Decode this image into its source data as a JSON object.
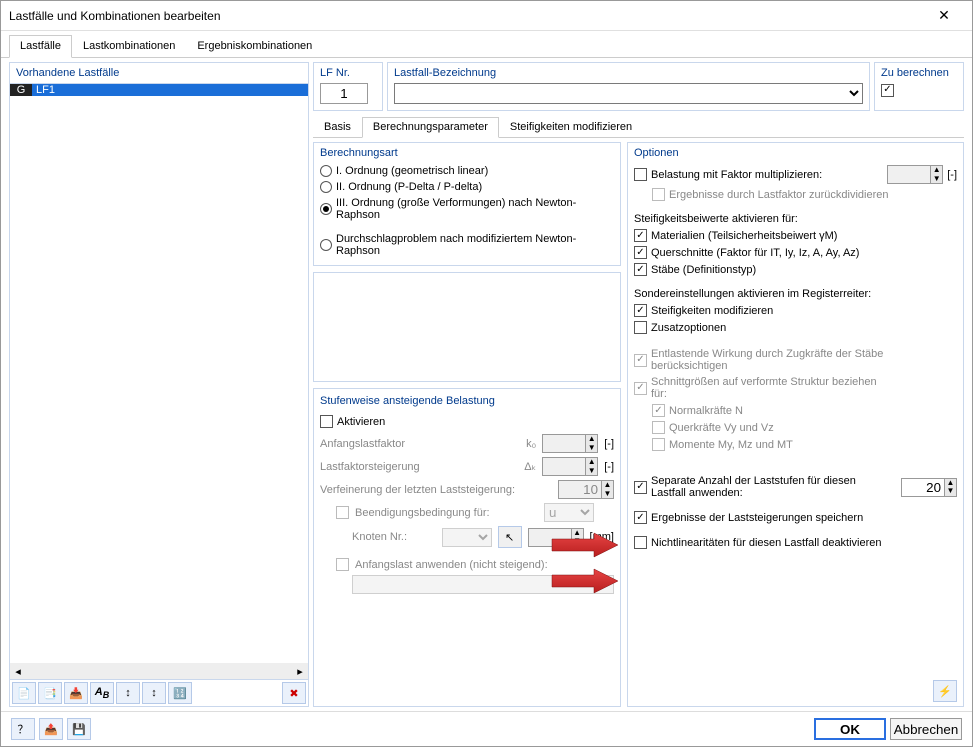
{
  "window": {
    "title": "Lastfälle und Kombinationen bearbeiten"
  },
  "tabs": [
    "Lastfälle",
    "Lastkombinationen",
    "Ergebniskombinationen"
  ],
  "left": {
    "header": "Vorhandene Lastfälle",
    "items": [
      {
        "tag": "G",
        "name": "LF1"
      }
    ]
  },
  "top": {
    "lfnr_label": "LF Nr.",
    "lfnr_value": "1",
    "bez_label": "Lastfall-Bezeichnung",
    "bez_value": "",
    "calc_label": "Zu berechnen"
  },
  "subtabs": [
    "Basis",
    "Berechnungsparameter",
    "Steifigkeiten modifizieren"
  ],
  "calc": {
    "group": "Berechnungsart",
    "m1": "I. Ordnung (geometrisch linear)",
    "m2": "II. Ordnung (P-Delta / P-delta)",
    "m3": "III. Ordnung (große Verformungen) nach Newton-Raphson",
    "m4": "Durchschlagproblem nach modifiziertem Newton-Raphson"
  },
  "step": {
    "group": "Stufenweise ansteigende Belastung",
    "enable": "Aktivieren",
    "row1": "Anfangslastfaktor",
    "sym1": "k₀",
    "row2": "Lastfaktorsteigerung",
    "sym2": "Δₖ",
    "row3": "Verfeinerung der letzten Laststeigerung:",
    "val3": "10",
    "row4": "Beendigungsbedingung für:",
    "val4": "u",
    "row5": "Knoten Nr.:",
    "unit5": "[mm]",
    "row6": "Anfangslast anwenden (nicht steigend):"
  },
  "opt": {
    "group": "Optionen",
    "o1": "Belastung mit Faktor multiplizieren:",
    "o1s": "Ergebnisse durch Lastfaktor zurückdividieren",
    "sect2": "Steifigkeitsbeiwerte aktivieren für:",
    "s1": "Materialien (Teilsicherheitsbeiwert γM)",
    "s2": "Querschnitte (Faktor für IT, Iy, Iz, A, Ay, Az)",
    "s3": "Stäbe (Definitionstyp)",
    "sect3": "Sondereinstellungen aktivieren im Registerreiter:",
    "r1": "Steifigkeiten modifizieren",
    "r2": "Zusatzoptionen",
    "d1": "Entlastende Wirkung durch Zugkräfte der Stäbe berücksichtigen",
    "d2": "Schnittgrößen auf verformte Struktur beziehen für:",
    "d2a": "Normalkräfte N",
    "d2b": "Querkräfte Vy und Vz",
    "d2c": "Momente My, Mz und MT",
    "x1": "Separate Anzahl der Laststufen für diesen Lastfall anwenden:",
    "x1v": "20",
    "x2": "Ergebnisse der Laststeigerungen speichern",
    "x3": "Nichtlinearitäten für diesen Lastfall deaktivieren"
  },
  "unit_dimless": "[-]",
  "footer": {
    "ok": "OK",
    "cancel": "Abbrechen"
  }
}
